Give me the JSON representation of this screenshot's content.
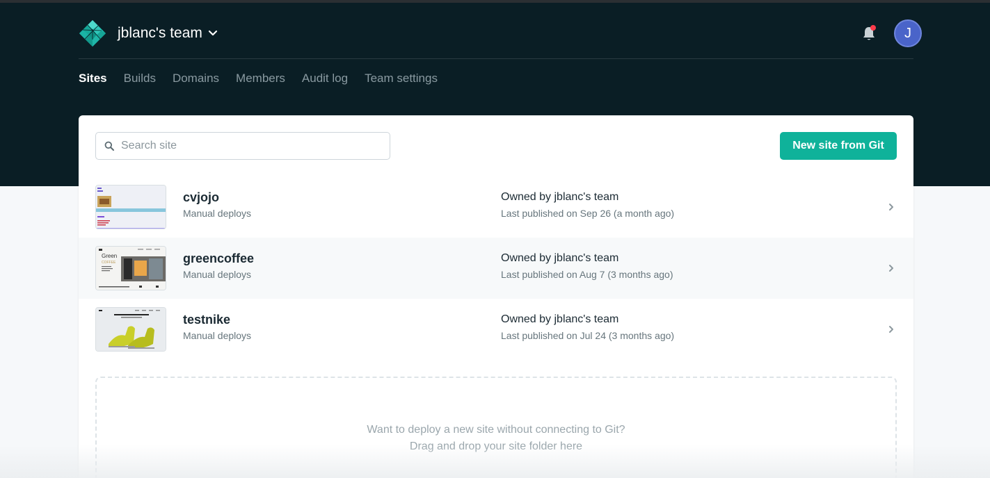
{
  "header": {
    "team_name": "jblanc's team",
    "avatar_initial": "J",
    "brand_color": "#0a1e25",
    "notification_dot_color": "#ff3b4a"
  },
  "nav": {
    "tabs": [
      {
        "label": "Sites",
        "active": true
      },
      {
        "label": "Builds",
        "active": false
      },
      {
        "label": "Domains",
        "active": false
      },
      {
        "label": "Members",
        "active": false
      },
      {
        "label": "Audit log",
        "active": false
      },
      {
        "label": "Team settings",
        "active": false
      }
    ]
  },
  "search": {
    "placeholder": "Search site",
    "value": ""
  },
  "new_site_button": {
    "label": "New site from Git",
    "color": "#0fb29a"
  },
  "sites": [
    {
      "name": "cvjojo",
      "deploy_type": "Manual deploys",
      "owner_prefix": "Owned by",
      "owner": "jblanc's team",
      "published": "Last published on Sep 26 (a month ago)"
    },
    {
      "name": "greencoffee",
      "deploy_type": "Manual deploys",
      "owner_prefix": "Owned by",
      "owner": "jblanc's team",
      "published": "Last published on Aug 7 (3 months ago)"
    },
    {
      "name": "testnike",
      "deploy_type": "Manual deploys",
      "owner_prefix": "Owned by",
      "owner": "jblanc's team",
      "published": "Last published on Jul 24 (3 months ago)"
    }
  ],
  "dropzone": {
    "line1": "Want to deploy a new site without connecting to Git?",
    "line2": "Drag and drop your site folder here"
  }
}
